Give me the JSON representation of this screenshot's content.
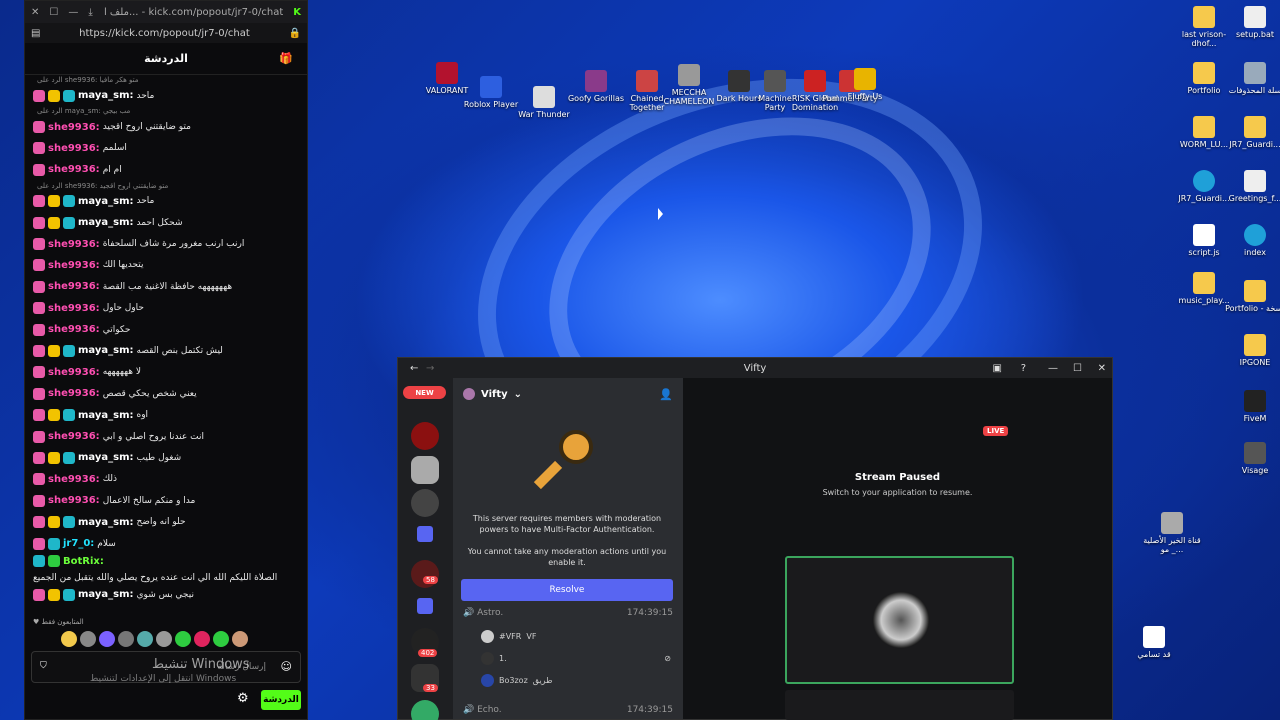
{
  "chat_window": {
    "tab_title": "ملف ا... - kick.com/popout/jr7-0/chat",
    "url": "https://kick.com/popout/jr7-0/chat",
    "header": "الدردشة",
    "messages": [
      {
        "reply": "الرد على she9936: متو هكر مافيا",
        "user": "maya_sm:",
        "text": "ماحد",
        "type": "maya"
      },
      {
        "reply": "الرد على maya_sm: مب بيجي",
        "user": "she9936:",
        "text": "متو ضايقتني اروح اقجيد",
        "type": "she"
      },
      {
        "reply": "",
        "user": "she9936:",
        "text": "اسلمم",
        "type": "she"
      },
      {
        "reply": "",
        "user": "she9936:",
        "text": "ام ام",
        "type": "she"
      },
      {
        "reply": "الرد على she9936: متو ضايقتني اروح اقجيد",
        "user": "maya_sm:",
        "text": "ماحد",
        "type": "maya"
      },
      {
        "reply": "",
        "user": "maya_sm:",
        "text": "شحكل احمد",
        "type": "maya"
      },
      {
        "reply": "",
        "user": "she9936:",
        "text": "ارنب ارنب مغرور مرة شاف السلحفاة",
        "type": "she"
      },
      {
        "reply": "",
        "user": "she9936:",
        "text": "يتحديها الك",
        "type": "she"
      },
      {
        "reply": "",
        "user": "she9936:",
        "text": "هههههههه حافظة الاغنية مب القصة",
        "type": "she"
      },
      {
        "reply": "",
        "user": "she9936:",
        "text": "حاول حاول",
        "type": "she"
      },
      {
        "reply": "",
        "user": "she9936:",
        "text": "حكواتي",
        "type": "she"
      },
      {
        "reply": "",
        "user": "maya_sm:",
        "text": "ليش تكتمل بنص القصه",
        "type": "maya"
      },
      {
        "reply": "",
        "user": "she9936:",
        "text": "لا ههههههه",
        "type": "she"
      },
      {
        "reply": "",
        "user": "she9936:",
        "text": "يعني شخص يحكي قصص",
        "type": "she"
      },
      {
        "reply": "",
        "user": "maya_sm:",
        "text": "اوه",
        "type": "maya"
      },
      {
        "reply": "",
        "user": "she9936:",
        "text": "انت عندنا يروح اصلي و ابي",
        "type": "she"
      },
      {
        "reply": "",
        "user": "maya_sm:",
        "text": "شغول طيب",
        "type": "maya"
      },
      {
        "reply": "",
        "user": "she9936:",
        "text": "ذلك",
        "type": "she"
      },
      {
        "reply": "",
        "user": "she9936:",
        "text": "مدا و منكم سالخ الاعمال",
        "type": "she"
      },
      {
        "reply": "",
        "user": "maya_sm:",
        "text": "حلو انه واضح",
        "type": "maya"
      },
      {
        "reply": "",
        "user": "jr7_0:",
        "text": "سلام",
        "type": "jr"
      },
      {
        "reply": "",
        "user": "BotRix:",
        "text": "الصلاة الليكم الله الي انت عنده يروح يصلي والله يتقبل من الجميع",
        "type": "bot"
      },
      {
        "reply": "",
        "user": "maya_sm:",
        "text": "نيجي بس شوي",
        "type": "maya"
      }
    ],
    "followers_label": "المتابعون فقط",
    "input_placeholder": "إرسال رسالة",
    "watermark_title": "تنشيط Windows",
    "watermark_sub": "انتقل إلى الإعدادات لتنشيط Windows",
    "send_label": "الدردشة"
  },
  "desktop_icons": {
    "valorant": "VALORANT",
    "roblox": "Roblox Player",
    "warthunder": "War Thunder",
    "goofy": "Goofy Gorillas",
    "chained": "Chained Together",
    "meccha": "MECCHA CHAMELEON",
    "darkhours": "Dark Hours",
    "machine": "Machine Party",
    "risk": "RISK Global Domination",
    "pummel": "Pummel Party",
    "fluffy": "Fluffy Us",
    "last": "last vrison-dhof...",
    "setup": "setup.bat",
    "portfolio": "Portfolio",
    "recycle": "سلة المحذوفات",
    "worm": "WORM_LU...",
    "jr7g1": "JR7_Guardi...",
    "jr7g2": "JR7_Guardi...",
    "greetings": "Greetings_f...",
    "script": "script.js",
    "index": "index",
    "music": "music_play...",
    "portfolio2": "Portfolio - نسخة",
    "ipgone": "IPGONE",
    "fivem": "FiveM",
    "visage": "Visage",
    "channel": "قناة الخير الأصلية _ مو...",
    "qad": "قد تسامي"
  },
  "discord": {
    "title": "Vifty",
    "server_name": "Vifty",
    "new_badge": "NEW",
    "badge_58": "58",
    "badge_402": "402",
    "badge_33": "33",
    "mfa_text": "This server requires members with moderation powers to have Multi-Factor Authentication.",
    "mfa_sub": "You cannot take any moderation actions until you enable it.",
    "resolve": "Resolve",
    "channel1": "Astro.",
    "channel1_time": "174:39:15",
    "user1": "#VFR",
    "user1_tag": "VF",
    "user2": "1.",
    "user3": "Bo3zoz",
    "user3_tag": "طريق",
    "channel2": "Echo.",
    "channel2_time": "174:39:15",
    "live": "LIVE",
    "stream_title": "Stream Paused",
    "stream_sub": "Switch to your application to resume."
  },
  "colors": {
    "kick_green": "#53fc18",
    "discord_blurple": "#5865f2",
    "live_red": "#ed4245"
  }
}
